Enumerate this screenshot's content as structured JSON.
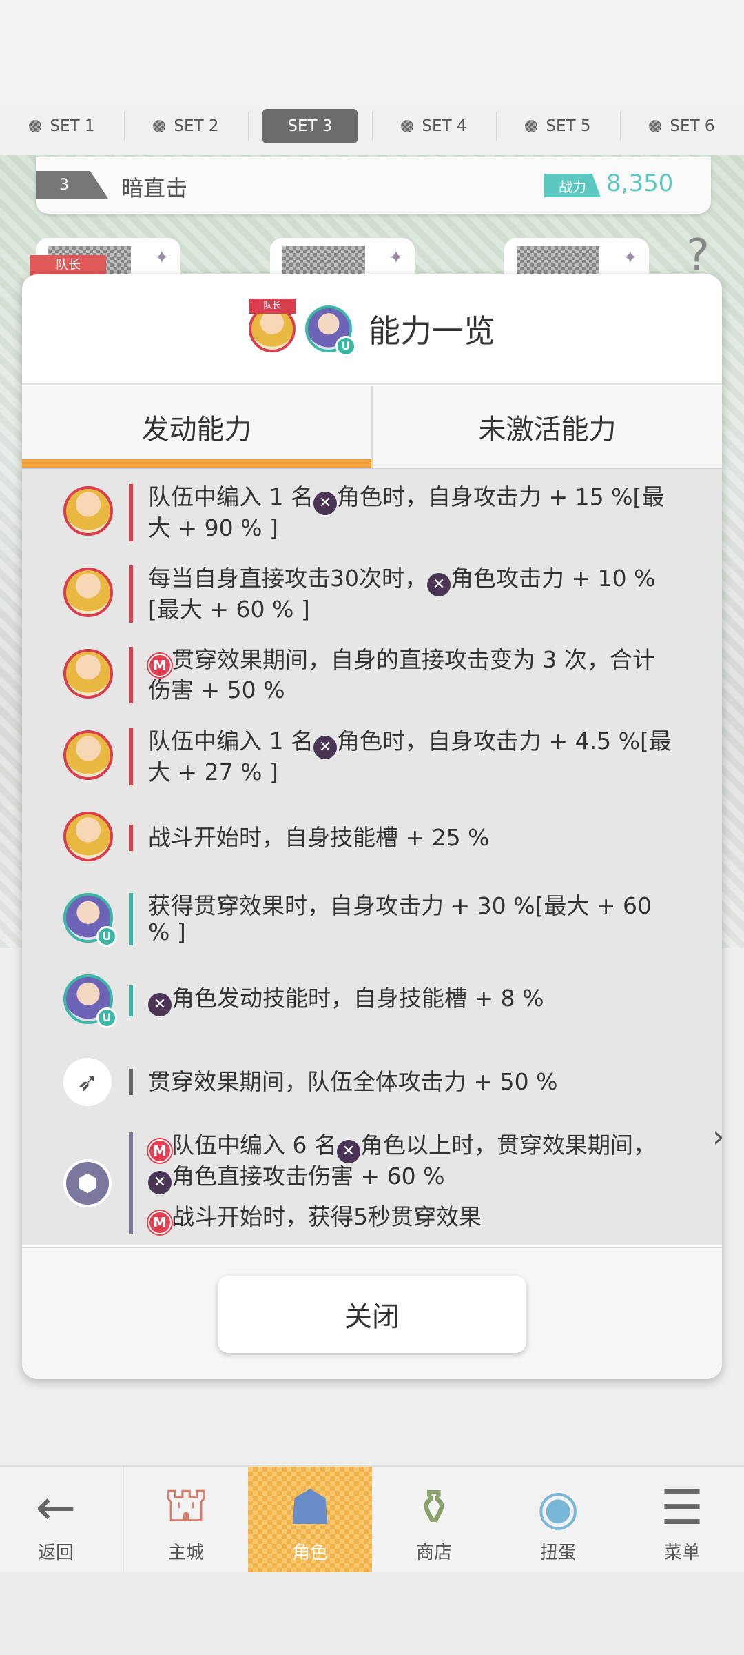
{
  "set_tabs": [
    {
      "label": "SET 1"
    },
    {
      "label": "SET 2"
    },
    {
      "label": "SET 3",
      "active": true
    },
    {
      "label": "SET 4"
    },
    {
      "label": "SET 5"
    },
    {
      "label": "SET 6"
    }
  ],
  "team": {
    "number": "3",
    "name": "暗直击",
    "power_label": "战力",
    "power_value": "8,350"
  },
  "leader_flag": "队长",
  "modal": {
    "captain_tag": "队长",
    "u_badge": "U",
    "title": "能力一览",
    "tabs": [
      {
        "label": "发动能力",
        "active": true
      },
      {
        "label": "未激活能力",
        "active": false
      }
    ],
    "abilities": [
      {
        "icon": "red-portrait",
        "color": "#d93e4f",
        "lines": [
          [
            "队伍中编入 1 名",
            "X",
            "角色时，自身攻击力 + 15 %[最大 + 90 % ]"
          ]
        ]
      },
      {
        "icon": "red-portrait",
        "color": "#d93e4f",
        "lines": [
          [
            "每当自身直接攻击30次时，",
            "X",
            "角色攻击力 + 10 %[最大 + 60 % ]"
          ]
        ]
      },
      {
        "icon": "red-portrait",
        "color": "#d93e4f",
        "lines": [
          [
            "",
            "M",
            "贯穿效果期间，自身的直接攻击变为 3 次，合计伤害 + 50 %"
          ]
        ]
      },
      {
        "icon": "red-portrait",
        "color": "#d93e4f",
        "lines": [
          [
            "队伍中编入 1 名",
            "X",
            "角色时，自身攻击力 + 4.5 %[最大 + 27 % ]"
          ]
        ]
      },
      {
        "icon": "red-portrait",
        "color": "#d93e4f",
        "lines": [
          [
            "战斗开始时，自身技能槽 + 25 %",
            "",
            ""
          ]
        ]
      },
      {
        "icon": "teal-portrait",
        "color": "#3bb7a6",
        "lines": [
          [
            "获得贯穿效果时，自身攻击力 + 30 %[最大 + 60 % ]",
            "",
            ""
          ]
        ]
      },
      {
        "icon": "teal-portrait",
        "color": "#3bb7a6",
        "lines": [
          [
            "",
            "X",
            "角色发动技能时，自身技能槽 + 8 %"
          ]
        ]
      },
      {
        "icon": "weapon-icon",
        "color": "#666666",
        "lines": [
          [
            "贯穿效果期间，队伍全体攻击力 + 50 %",
            "",
            ""
          ]
        ]
      },
      {
        "icon": "chest-icon",
        "color": "#7a789c",
        "lines": [
          [
            "",
            "M",
            "队伍中编入 6 名",
            "X",
            "角色以上时，贯穿效果期间，",
            "X",
            "角色直接攻击伤害 + 60 %"
          ],
          [
            "",
            "M",
            "战斗开始时，获得5秒贯穿效果"
          ]
        ]
      }
    ],
    "close_label": "关闭"
  },
  "bottom_nav": [
    {
      "label": "返回",
      "icon": "back-arrow-icon"
    },
    {
      "label": "主城",
      "icon": "town-icon"
    },
    {
      "label": "角色",
      "icon": "character-icon",
      "active": true
    },
    {
      "label": "商店",
      "icon": "shop-icon"
    },
    {
      "label": "扭蛋",
      "icon": "gacha-icon"
    },
    {
      "label": "菜单",
      "icon": "menu-icon"
    }
  ]
}
